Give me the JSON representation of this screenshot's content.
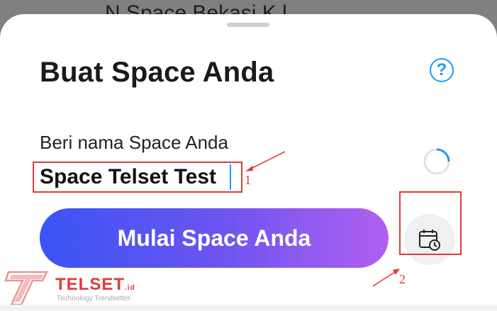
{
  "background": {
    "partial_text": "N            Space Bekasi K l"
  },
  "sheet": {
    "title": "Buat Space Anda",
    "help_icon": "question-circle-icon",
    "name_label": "Beri nama Space Anda",
    "name_value": "Space Telset Test",
    "loading_icon": "spinner-icon",
    "start_button_label": "Mulai Space Anda",
    "schedule_icon": "calendar-clock-icon"
  },
  "annotations": {
    "marker_1": "1",
    "marker_2": "2"
  },
  "watermark": {
    "brand": "TELSET",
    "suffix": ".id",
    "tagline": "Technology Trendsetter"
  },
  "colors": {
    "accent_blue": "#1d9bf0",
    "gradient_start": "#3a54f5",
    "gradient_end": "#b15ff0",
    "annotation_red": "#e23a3a"
  }
}
